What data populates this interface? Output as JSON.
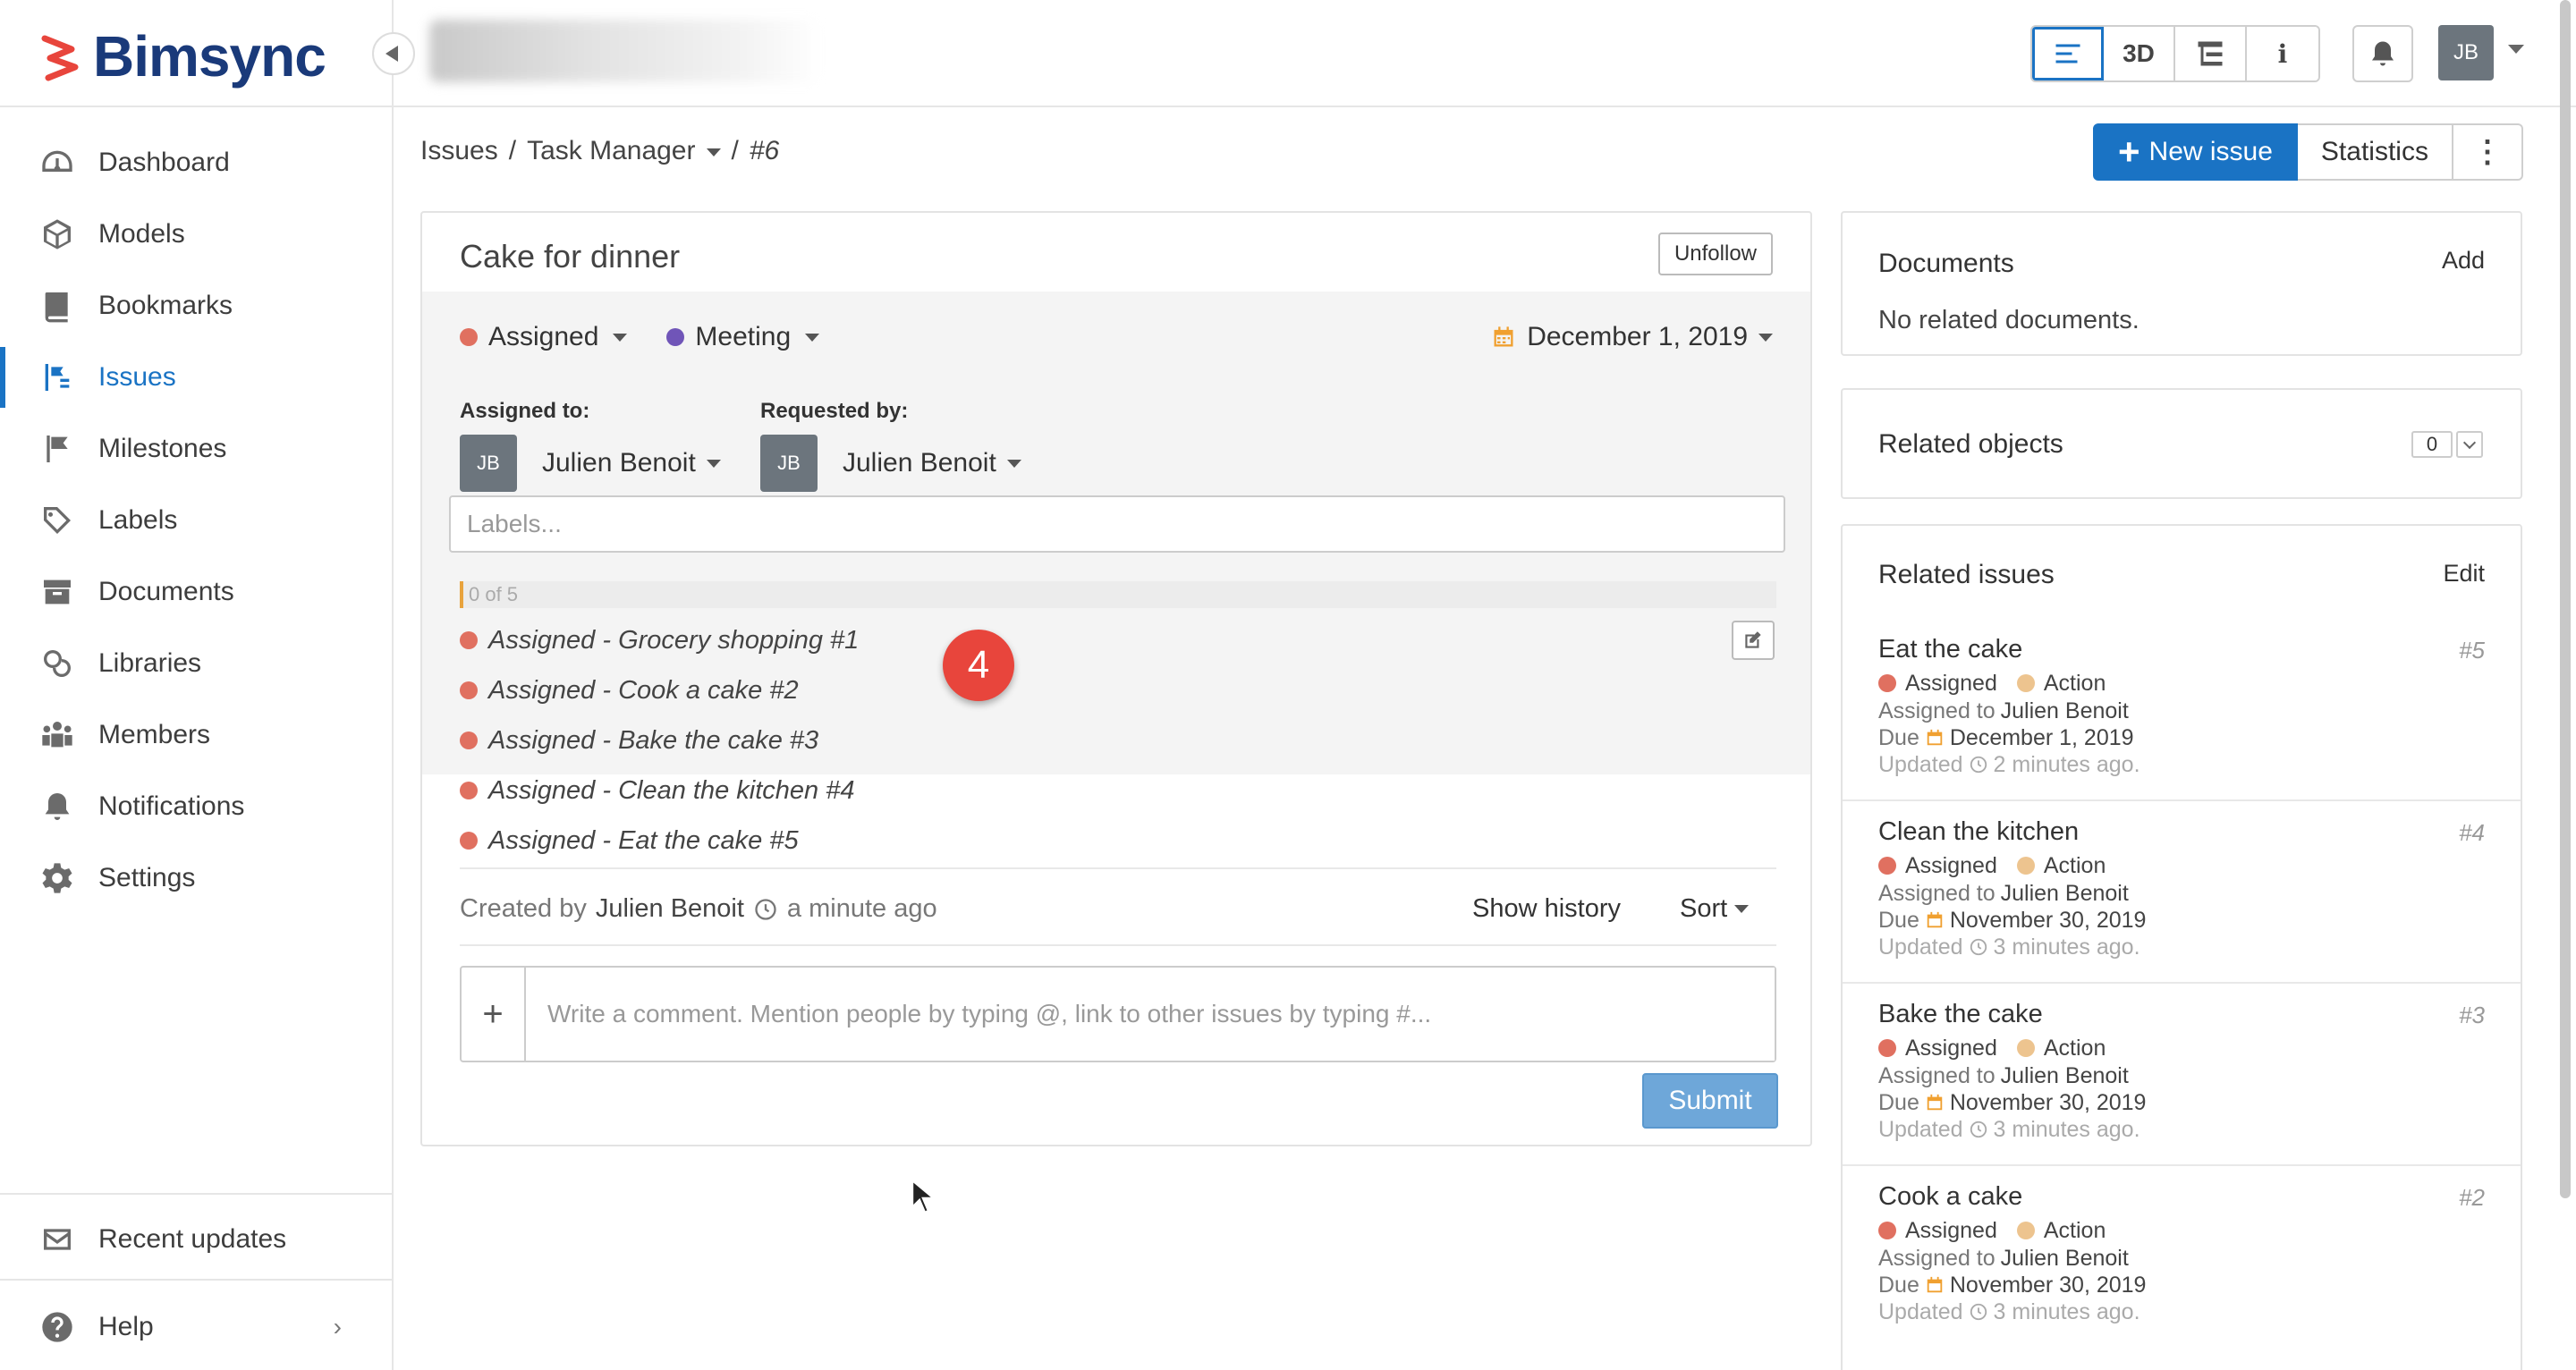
{
  "app": {
    "logo_text": "Bimsync"
  },
  "sidebar": {
    "items": [
      {
        "label": "Dashboard",
        "icon": "dashboard-icon"
      },
      {
        "label": "Models",
        "icon": "cube-icon"
      },
      {
        "label": "Bookmarks",
        "icon": "bookmark-icon"
      },
      {
        "label": "Issues",
        "icon": "issues-icon",
        "active": true
      },
      {
        "label": "Milestones",
        "icon": "flag-icon"
      },
      {
        "label": "Labels",
        "icon": "tag-icon"
      },
      {
        "label": "Documents",
        "icon": "archive-icon"
      },
      {
        "label": "Libraries",
        "icon": "libraries-icon"
      },
      {
        "label": "Members",
        "icon": "members-icon"
      },
      {
        "label": "Notifications",
        "icon": "bell-icon"
      },
      {
        "label": "Settings",
        "icon": "gear-icon"
      }
    ],
    "bottom": {
      "recent": "Recent updates",
      "help": "Help",
      "help_chevron": "›"
    }
  },
  "topbar": {
    "view_3d": "3D",
    "view_info": "i",
    "user_initials": "JB"
  },
  "breadcrumb": {
    "root": "Issues",
    "sep": "/",
    "board": "Task Manager",
    "current": "#6"
  },
  "header": {
    "new_issue": "New issue",
    "new_issue_plus": "+",
    "statistics": "Statistics",
    "more": "⋮"
  },
  "issue": {
    "title": "Cake for dinner",
    "unfollow": "Unfollow",
    "status": "Assigned",
    "type": "Meeting",
    "due": "December 1, 2019",
    "assigned_to_label": "Assigned to:",
    "requested_by_label": "Requested by:",
    "assignee": {
      "initials": "JB",
      "name": "Julien Benoit"
    },
    "requester": {
      "initials": "JB",
      "name": "Julien Benoit"
    },
    "labels_placeholder": "Labels...",
    "progress_text": "0 of 5",
    "progress": {
      "done": 0,
      "total": 5
    },
    "step_badge": "4",
    "subtasks": [
      "Assigned - Grocery shopping #1",
      "Assigned - Cook a cake #2",
      "Assigned - Bake the cake #3",
      "Assigned - Clean the kitchen #4",
      "Assigned - Eat the cake #5"
    ],
    "created_prefix": "Created by",
    "created_author": "Julien Benoit",
    "created_time": "a minute ago",
    "show_history": "Show history",
    "sort": "Sort",
    "comment_plus": "+",
    "comment_placeholder": "Write a comment. Mention people by typing @, link to other issues by typing #...",
    "submit": "Submit"
  },
  "documents": {
    "title": "Documents",
    "add": "Add",
    "empty": "No related documents."
  },
  "related_objects": {
    "title": "Related objects",
    "count": "0"
  },
  "related_issues": {
    "title": "Related issues",
    "edit": "Edit",
    "items": [
      {
        "title": "Eat the cake",
        "num": "#5",
        "status": "Assigned",
        "type": "Action",
        "assigned_prefix": "Assigned to",
        "assignee": "Julien Benoit",
        "due_prefix": "Due",
        "due": "December 1, 2019",
        "updated_prefix": "Updated",
        "updated": "2 minutes ago."
      },
      {
        "title": "Clean the kitchen",
        "num": "#4",
        "status": "Assigned",
        "type": "Action",
        "assigned_prefix": "Assigned to",
        "assignee": "Julien Benoit",
        "due_prefix": "Due",
        "due": "November 30, 2019",
        "updated_prefix": "Updated",
        "updated": "3 minutes ago."
      },
      {
        "title": "Bake the cake",
        "num": "#3",
        "status": "Assigned",
        "type": "Action",
        "assigned_prefix": "Assigned to",
        "assignee": "Julien Benoit",
        "due_prefix": "Due",
        "due": "November 30, 2019",
        "updated_prefix": "Updated",
        "updated": "3 minutes ago."
      },
      {
        "title": "Cook a cake",
        "num": "#2",
        "status": "Assigned",
        "type": "Action",
        "assigned_prefix": "Assigned to",
        "assignee": "Julien Benoit",
        "due_prefix": "Due",
        "due": "November 30, 2019",
        "updated_prefix": "Updated",
        "updated": "3 minutes ago."
      }
    ]
  },
  "colors": {
    "accent": "#1a73c4",
    "status_assigned": "#e07060",
    "type_meeting": "#7055b8",
    "type_action": "#edc48f",
    "calendar": "#f0a030",
    "progress_marker": "#e8a33d"
  }
}
